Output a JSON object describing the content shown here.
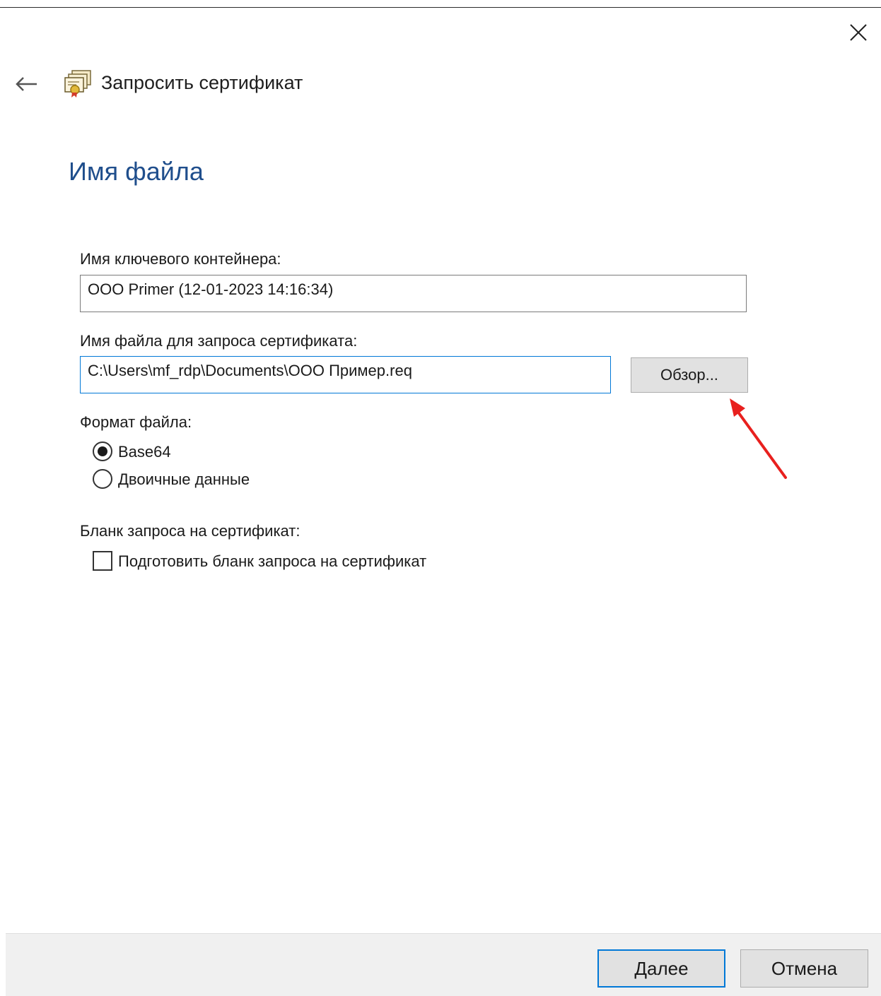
{
  "window": {
    "title": "Запросить сертификат"
  },
  "page": {
    "heading": "Имя файла"
  },
  "container_name": {
    "label": "Имя ключевого контейнера:",
    "value": "ООО Primer (12-01-2023 14:16:34)"
  },
  "request_file": {
    "label": "Имя файла для запроса сертификата:",
    "value": "C:\\Users\\mf_rdp\\Documents\\ООО Пример.req",
    "browse_label": "Обзор..."
  },
  "file_format": {
    "label": "Формат файла:",
    "options": [
      {
        "label": "Base64",
        "selected": true
      },
      {
        "label": "Двоичные данные",
        "selected": false
      }
    ]
  },
  "request_form": {
    "label": "Бланк запроса на сертификат:",
    "checkbox_label": "Подготовить бланк запроса на сертификат",
    "checked": false
  },
  "footer": {
    "next_label": "Далее",
    "cancel_label": "Отмена"
  },
  "annotation": {
    "arrow_color": "#e8201e"
  },
  "icons": {
    "back": "back-arrow-icon",
    "close": "close-icon",
    "wizard": "certificate-icon"
  }
}
